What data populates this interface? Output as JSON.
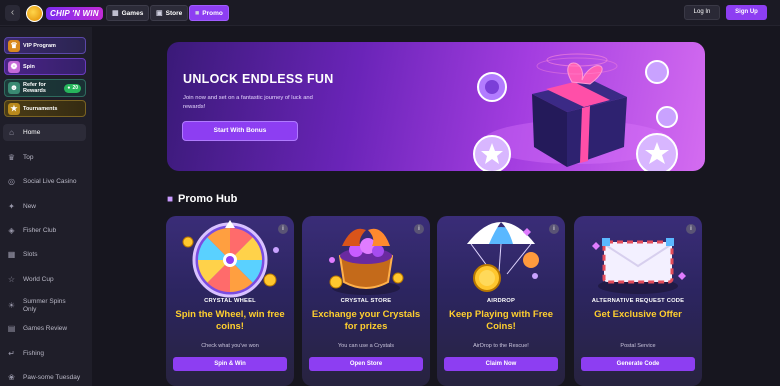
{
  "header": {
    "back_icon": "chevron-left-icon",
    "logo_text": "CHIP 'N WIN",
    "nav": [
      {
        "label": "Games",
        "icon": "gamepad-icon"
      },
      {
        "label": "Store",
        "icon": "store-icon"
      },
      {
        "label": "Promo",
        "icon": "gift-icon",
        "active": true
      }
    ],
    "login_label": "Log In",
    "signup_label": "Sign Up"
  },
  "sidebar": {
    "promos": {
      "vip": "VIP Program",
      "spin": "Spin",
      "refer": "Refer for Rewards",
      "refer_badge": "20",
      "tournaments": "Tournaments"
    },
    "items": [
      {
        "label": "Home",
        "icon": "home-icon",
        "active": true
      },
      {
        "label": "Top",
        "icon": "crown-icon"
      },
      {
        "label": "Social Live Casino",
        "icon": "live-icon"
      },
      {
        "label": "New",
        "icon": "sparkle-icon"
      },
      {
        "label": "Fisher Club",
        "icon": "fish-icon"
      },
      {
        "label": "Slots",
        "icon": "slots-icon"
      },
      {
        "label": "World Cup",
        "icon": "trophy-icon"
      },
      {
        "label": "Summer Spins Only",
        "icon": "sun-icon"
      },
      {
        "label": "Games Review",
        "icon": "review-icon"
      },
      {
        "label": "Fishing",
        "icon": "hook-icon"
      },
      {
        "label": "Paw-some Tuesday",
        "icon": "paw-icon"
      }
    ]
  },
  "hero": {
    "title": "UNLOCK ENDLESS FUN",
    "subtitle": "Join now and set on a fantastic journey of luck and rewards!",
    "button": "Start With Bonus"
  },
  "promo_hub": {
    "title": "Promo Hub",
    "cards": [
      {
        "label": "CRYSTAL WHEEL",
        "headline": "Spin the Wheel, win free coins!",
        "note": "Check what you've won",
        "button": "Spin & Win"
      },
      {
        "label": "CRYSTAL STORE",
        "headline": "Exchange your Crystals for prizes",
        "note": "You can use a Crystals",
        "button": "Open Store"
      },
      {
        "label": "AIRDROP",
        "headline": "Keep Playing with Free Coins!",
        "note": "AirDrop to the Rescue!",
        "button": "Claim Now"
      },
      {
        "label": "ALTERNATIVE REQUEST CODE",
        "headline": "Get Exclusive Offer",
        "note": "Postal Service",
        "button": "Generate Code"
      }
    ]
  },
  "colors": {
    "accent": "#8d3ef2",
    "headline": "#ffcf2e",
    "background": "#17161f"
  }
}
